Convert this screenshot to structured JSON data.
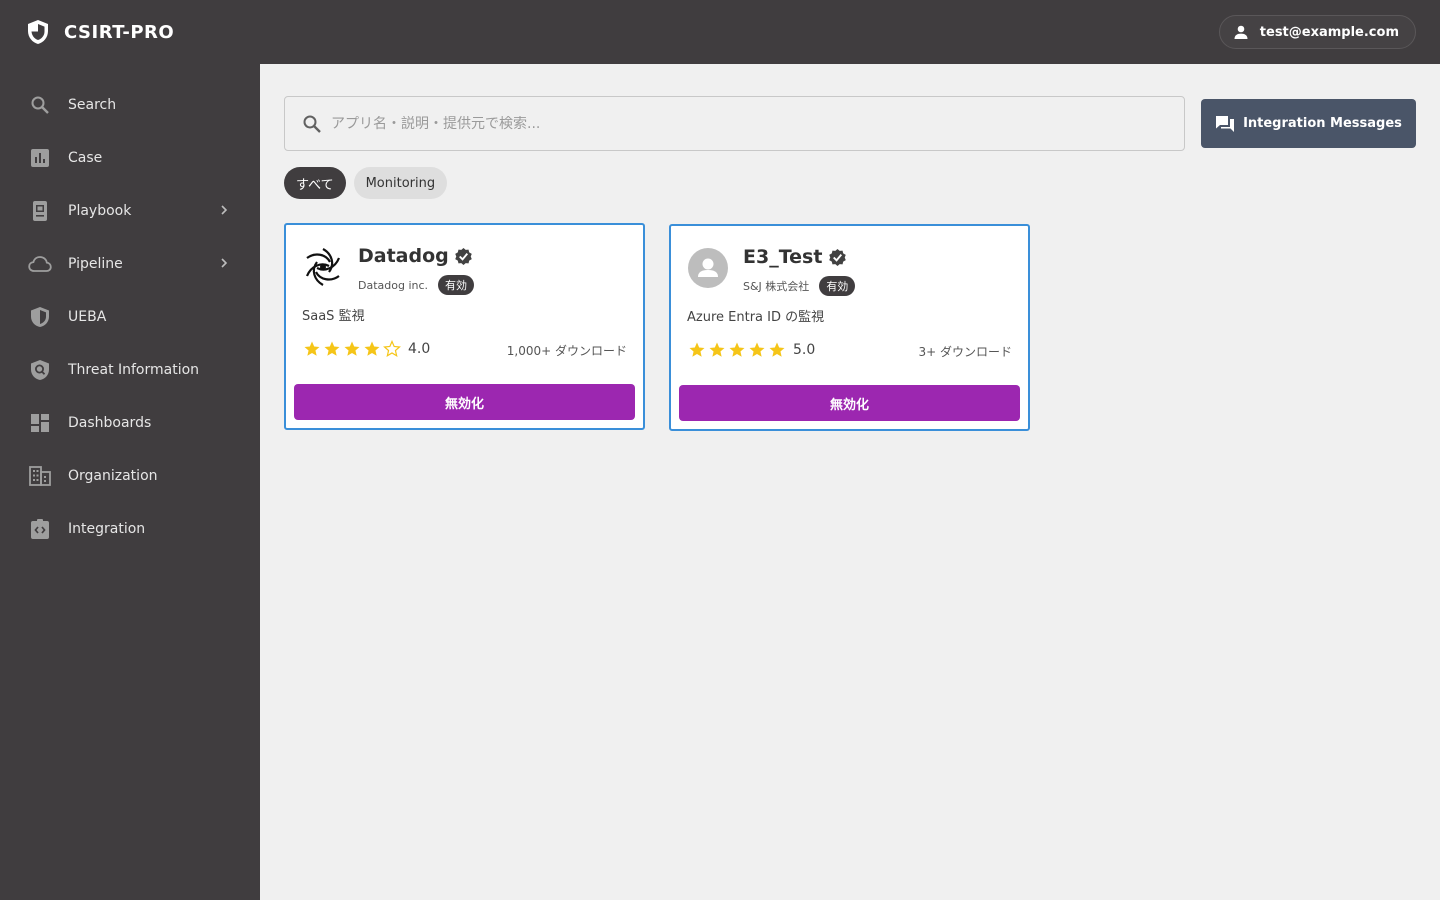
{
  "app": {
    "title": "CSIRT-PRO"
  },
  "user": {
    "email": "test@example.com"
  },
  "sidebar": {
    "items": [
      {
        "label": "Search",
        "icon": "search-icon"
      },
      {
        "label": "Case",
        "icon": "bar-chart-icon"
      },
      {
        "label": "Playbook",
        "icon": "book-icon",
        "has_submenu": true
      },
      {
        "label": "Pipeline",
        "icon": "cloud-icon",
        "has_submenu": true
      },
      {
        "label": "UEBA",
        "icon": "shield-icon"
      },
      {
        "label": "Threat Information",
        "icon": "shield-search-icon"
      },
      {
        "label": "Dashboards",
        "icon": "dashboard-icon"
      },
      {
        "label": "Organization",
        "icon": "building-icon"
      },
      {
        "label": "Integration",
        "icon": "integration-icon"
      }
    ]
  },
  "search": {
    "placeholder": "アプリ名・説明・提供元で検索...",
    "value": ""
  },
  "toolbar": {
    "messages_label": "Integration Messages"
  },
  "filters": [
    {
      "label": "すべて",
      "active": true
    },
    {
      "label": "Monitoring",
      "active": false
    }
  ],
  "cards": [
    {
      "name": "Datadog",
      "vendor": "Datadog inc.",
      "status": "有効",
      "description": "SaaS 監視",
      "rating": 4.0,
      "rating_label": "4.0",
      "downloads": "1,000+ ダウンロード",
      "action_label": "無効化",
      "logo": "datadog-logo-icon"
    },
    {
      "name": "E3_Test",
      "vendor": "S&J 株式会社",
      "status": "有効",
      "description": "Azure Entra ID の監視",
      "rating": 5.0,
      "rating_label": "5.0",
      "downloads": "3+ ダウンロード",
      "action_label": "無効化",
      "logo": "avatar-placeholder-icon"
    }
  ],
  "colors": {
    "sidebar_bg": "#403d3f",
    "accent_purple": "#9c27b0",
    "card_border": "#3a8fd9",
    "star": "#f5c518",
    "button_dark": "#4a5568"
  }
}
